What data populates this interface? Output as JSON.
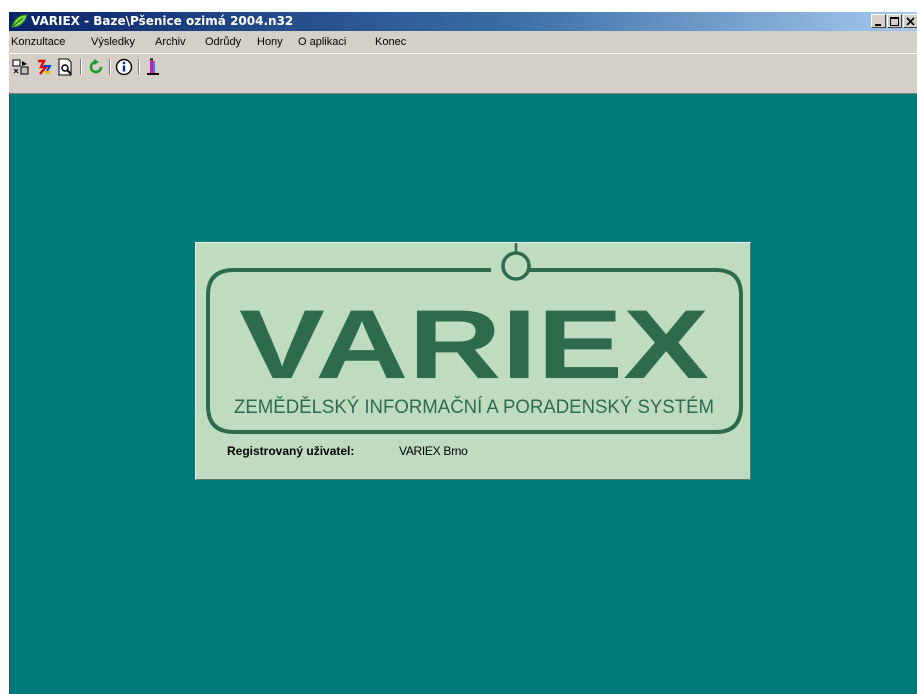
{
  "window": {
    "title": "VARIEX - Baze\\Pšenice ozimá 2004.n32",
    "controls": [
      "minimize",
      "maximize",
      "close"
    ]
  },
  "menu": {
    "items": [
      "Konzultace",
      "Výsledky",
      "Archiv",
      "Odrůdy",
      "Hony",
      "O aplikaci",
      "Konec"
    ]
  },
  "toolbar": {
    "icons": [
      "config-icon",
      "chart-icon",
      "print-preview-icon",
      "refresh-icon",
      "info-icon",
      "exit-icon"
    ]
  },
  "splash": {
    "logo_text": "VARIEX",
    "tagline": "ZEMĚDĚLSKÝ INFORMAČNÍ A PORADENSKÝ SYSTÉM",
    "registered_label": "Registrovaný uživatel:",
    "registered_user": "VARIEX Brno"
  },
  "colors": {
    "client_background": "#007b7b",
    "splash_background": "#c0dcc0",
    "logo_green": "#2e6b4c",
    "titlebar_start": "#0a246a",
    "titlebar_end": "#a6caf0"
  }
}
